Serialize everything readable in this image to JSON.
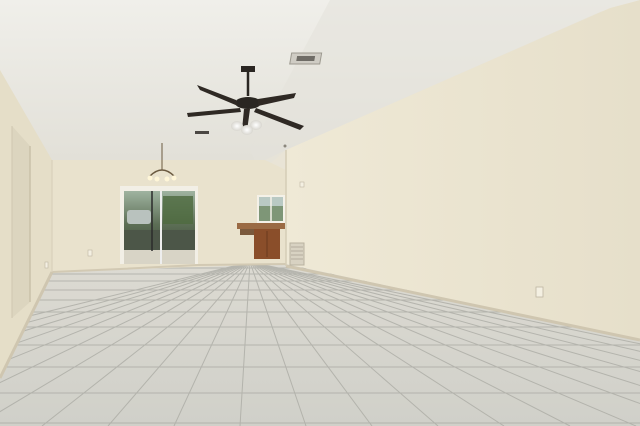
{
  "scene": {
    "kind": "empty-room-interior",
    "palette": {
      "ceiling": "#e7e5df",
      "wall_light": "#ece6d2",
      "wall_shadow": "#ddd6c3",
      "back_wall": "#e9e2cd",
      "floor_tile": "#d6d6cf",
      "grout": "#a9a9a2",
      "baseboard": "#cfc6b0",
      "fan_dark": "#2a2622",
      "cabinet": "#8a4e2a",
      "glass_door": "#6c7a6a"
    },
    "elements": [
      "vaulted-textured-ceiling",
      "ceiling-fan-with-light",
      "chandelier",
      "hvac-vent",
      "sliding-glass-door",
      "kitchen-cabinet-counter",
      "window",
      "return-air-grille",
      "hallway-opening",
      "tile-floor",
      "electrical-outlet"
    ]
  }
}
